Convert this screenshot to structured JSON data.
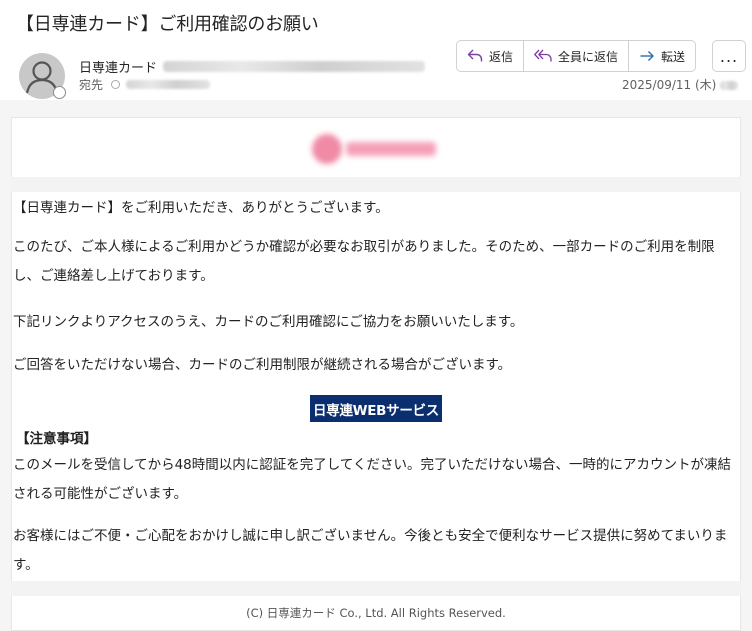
{
  "email": {
    "subject": "【日専連カード】ご利用確認のお願い",
    "from_name": "日専連カード",
    "to_label": "宛先",
    "date": "2025/09/11 (木)"
  },
  "actions": {
    "reply": "返信",
    "reply_all": "全員に返信",
    "forward": "転送",
    "more": "..."
  },
  "colors": {
    "cta_bg": "#0a2e6e",
    "reply_icon": "#7b3fa0",
    "forward_icon": "#2b6cb0"
  },
  "body": {
    "p1": "【日専連カード】をご利用いただき、ありがとうございます。",
    "p2": "このたび、ご本人様によるご利用かどうか確認が必要なお取引がありました。そのため、一部カードのご利用を制限し、ご連絡差し上げております。",
    "p3": "下記リンクよりアクセスのうえ、カードのご利用確認にご協力をお願いいたします。",
    "p4": "ご回答をいただけない場合、カードのご利用制限が継続される場合がございます。",
    "cta_label": "日専連WEBサービス",
    "notice_heading": "【注意事項】",
    "p5": "このメールを受信してから48時間以内に認証を完了してください。完了いただけない場合、一時的にアカウントが凍結される可能性がございます。",
    "p6": "お客様にはご不便・ご心配をおかけし誠に申し訳ございません。今後とも安全で便利なサービス提供に努めてまいります。"
  },
  "footer": {
    "copyright": "(C) 日専連カード Co., Ltd. All Rights Reserved."
  }
}
